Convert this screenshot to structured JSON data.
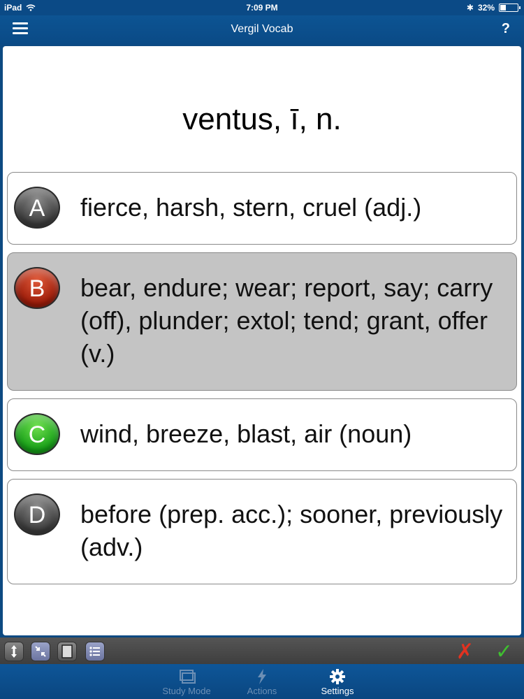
{
  "status": {
    "device": "iPad",
    "time": "7:09 PM",
    "battery_pct": "32%",
    "battery_level": 0.32
  },
  "nav": {
    "title": "Vergil Vocab",
    "help_label": "?"
  },
  "card": {
    "prompt": "ventus, ī, n.",
    "answers": [
      {
        "letter": "A",
        "text": "fierce, harsh, stern, cruel (adj.)",
        "color": "#5a5a5a"
      },
      {
        "letter": "B",
        "text": "bear, endure; wear; report, say; carry (off), plunder; extol; tend; grant, offer (v.)",
        "color": "#b3260d",
        "selected": true
      },
      {
        "letter": "C",
        "text": "wind, breeze, blast, air (noun)",
        "color": "#22b31c"
      },
      {
        "letter": "D",
        "text": "before (prep. acc.); sooner, previously (adv.)",
        "color": "#5a5a5a"
      }
    ]
  },
  "toolbar": {
    "icons": [
      "resize-vertical-icon",
      "shrink-icon",
      "card-icon",
      "list-icon"
    ],
    "wrong_icon": "x-mark-icon",
    "correct_icon": "check-mark-icon"
  },
  "tabs": [
    {
      "label": "Study Mode",
      "icon": "cards-icon",
      "active": false
    },
    {
      "label": "Actions",
      "icon": "lightning-icon",
      "active": false
    },
    {
      "label": "Settings",
      "icon": "gear-icon",
      "active": true
    }
  ]
}
